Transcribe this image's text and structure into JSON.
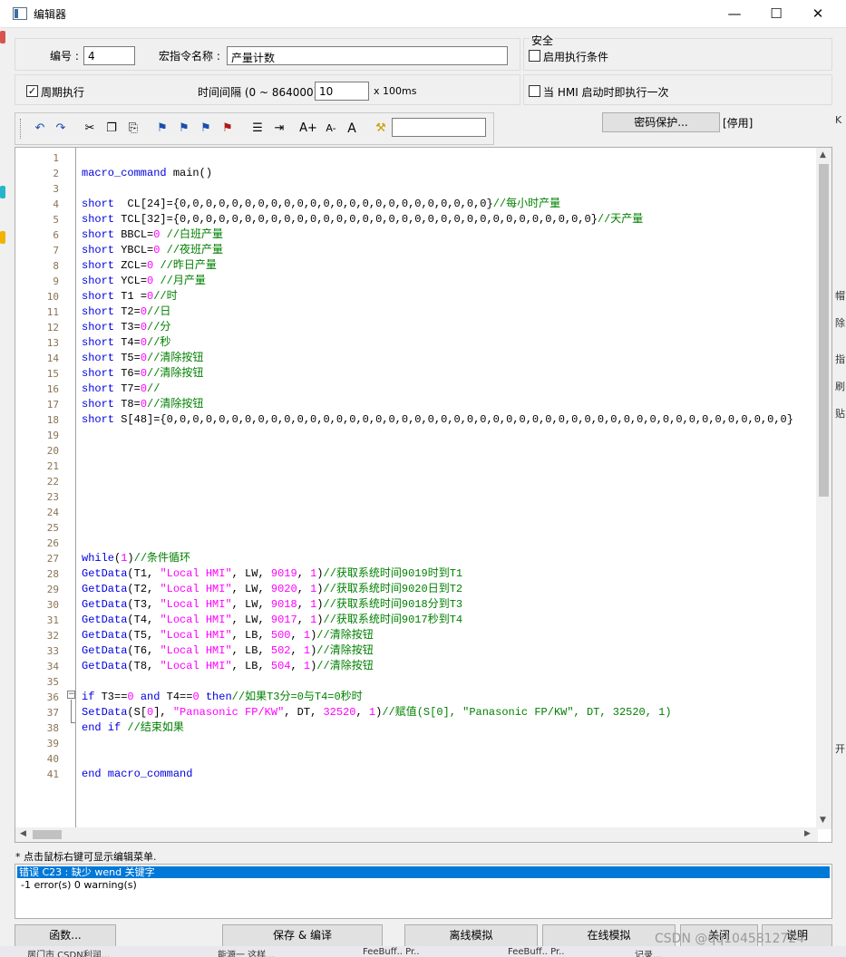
{
  "window": {
    "title": "编辑器",
    "min_icon": "minimize-icon",
    "max_icon": "maximize-icon",
    "close_icon": "close-icon"
  },
  "form": {
    "number_label": "编号 :",
    "number_value": "4",
    "macro_name_label": "宏指令名称 :",
    "macro_name_value": "产量计数",
    "security_title": "安全",
    "enable_condition_label": "启用执行条件",
    "enable_condition_checked": false,
    "periodic_label": "周期执行",
    "periodic_checked": true,
    "interval_label": "时间间隔 (0 ~ 864000) :",
    "interval_value": "10",
    "interval_unit": "x 100ms",
    "hmi_startup_label": "当 HMI 启动时即执行一次",
    "hmi_startup_checked": false,
    "password_button": "密码保护...",
    "status": "[停用]"
  },
  "toolbar": {
    "icons": [
      "undo-icon",
      "redo-icon",
      "cut-icon",
      "copy-icon",
      "paste-icon",
      "bookmark-icon",
      "bookmark-next-icon",
      "bookmark-prev-icon",
      "bookmark-clear-icon",
      "list-icon",
      "indent-icon",
      "font-increase-icon",
      "font-decrease-icon",
      "font-icon",
      "find-icon"
    ],
    "font_increase": "A+",
    "font_decrease": "A-",
    "font": "A",
    "search_value": ""
  },
  "code_lines": [
    {
      "n": "1",
      "html": ""
    },
    {
      "n": "2",
      "html": "<span class='kw'>macro_command</span> main()"
    },
    {
      "n": "3",
      "html": ""
    },
    {
      "n": "4",
      "html": "<span class='kw'>short</span>  CL[24]={0,0,0,0,0,0,0,0,0,0,0,0,0,0,0,0,0,0,0,0,0,0,0,0}<span class='cm'>//每小时产量</span>"
    },
    {
      "n": "5",
      "html": "<span class='kw'>short</span> TCL[32]={0,0,0,0,0,0,0,0,0,0,0,0,0,0,0,0,0,0,0,0,0,0,0,0,0,0,0,0,0,0,0,0}<span class='cm'>//天产量</span>"
    },
    {
      "n": "6",
      "html": "<span class='kw'>short</span> BBCL=<span class='num'>0</span> <span class='cm'>//白班产量</span>"
    },
    {
      "n": "7",
      "html": "<span class='kw'>short</span> YBCL=<span class='num'>0</span> <span class='cm'>//夜班产量</span>"
    },
    {
      "n": "8",
      "html": "<span class='kw'>short</span> ZCL=<span class='num'>0</span> <span class='cm'>//昨日产量</span>"
    },
    {
      "n": "9",
      "html": "<span class='kw'>short</span> YCL=<span class='num'>0</span> <span class='cm'>//月产量</span>"
    },
    {
      "n": "10",
      "html": "<span class='kw'>short</span> T1 =<span class='num'>0</span><span class='cm'>//时</span>"
    },
    {
      "n": "11",
      "html": "<span class='kw'>short</span> T2=<span class='num'>0</span><span class='cm'>//日</span>"
    },
    {
      "n": "12",
      "html": "<span class='kw'>short</span> T3=<span class='num'>0</span><span class='cm'>//分</span>"
    },
    {
      "n": "13",
      "html": "<span class='kw'>short</span> T4=<span class='num'>0</span><span class='cm'>//秒</span>"
    },
    {
      "n": "14",
      "html": "<span class='kw'>short</span> T5=<span class='num'>0</span><span class='cm'>//清除按钮</span>"
    },
    {
      "n": "15",
      "html": "<span class='kw'>short</span> T6=<span class='num'>0</span><span class='cm'>//清除按钮</span>"
    },
    {
      "n": "16",
      "html": "<span class='kw'>short</span> T7=<span class='num'>0</span><span class='cm'>//</span>"
    },
    {
      "n": "17",
      "html": "<span class='kw'>short</span> T8=<span class='num'>0</span><span class='cm'>//清除按钮</span>"
    },
    {
      "n": "18",
      "html": "<span class='kw'>short</span> S[48]={0,0,0,0,0,0,0,0,0,0,0,0,0,0,0,0,0,0,0,0,0,0,0,0,0,0,0,0,0,0,0,0,0,0,0,0,0,0,0,0,0,0,0,0,0,0,0,0}"
    },
    {
      "n": "19",
      "html": ""
    },
    {
      "n": "20",
      "html": ""
    },
    {
      "n": "21",
      "html": ""
    },
    {
      "n": "22",
      "html": ""
    },
    {
      "n": "23",
      "html": ""
    },
    {
      "n": "24",
      "html": ""
    },
    {
      "n": "25",
      "html": ""
    },
    {
      "n": "26",
      "html": ""
    },
    {
      "n": "27",
      "html": "<span class='kw'>while</span>(<span class='num'>1</span>)<span class='cm'>//条件循环</span>"
    },
    {
      "n": "28",
      "html": "<span class='fn'>GetData</span>(T1, <span class='str'>\"Local HMI\"</span>, LW, <span class='num'>9019</span>, <span class='num'>1</span>)<span class='cm'>//获取系统时间9019时到T1</span>"
    },
    {
      "n": "29",
      "html": "<span class='fn'>GetData</span>(T2, <span class='str'>\"Local HMI\"</span>, LW, <span class='num'>9020</span>, <span class='num'>1</span>)<span class='cm'>//获取系统时间9020日到T2</span>"
    },
    {
      "n": "30",
      "html": "<span class='fn'>GetData</span>(T3, <span class='str'>\"Local HMI\"</span>, LW, <span class='num'>9018</span>, <span class='num'>1</span>)<span class='cm'>//获取系统时间9018分到T3</span>"
    },
    {
      "n": "31",
      "html": "<span class='fn'>GetData</span>(T4, <span class='str'>\"Local HMI\"</span>, LW, <span class='num'>9017</span>, <span class='num'>1</span>)<span class='cm'>//获取系统时间9017秒到T4</span>"
    },
    {
      "n": "32",
      "html": "<span class='fn'>GetData</span>(T5, <span class='str'>\"Local HMI\"</span>, LB, <span class='num'>500</span>, <span class='num'>1</span>)<span class='cm'>//清除按钮</span>"
    },
    {
      "n": "33",
      "html": "<span class='fn'>GetData</span>(T6, <span class='str'>\"Local HMI\"</span>, LB, <span class='num'>502</span>, <span class='num'>1</span>)<span class='cm'>//清除按钮</span>"
    },
    {
      "n": "34",
      "html": "<span class='fn'>GetData</span>(T8, <span class='str'>\"Local HMI\"</span>, LB, <span class='num'>504</span>, <span class='num'>1</span>)<span class='cm'>//清除按钮</span>"
    },
    {
      "n": "35",
      "html": ""
    },
    {
      "n": "36",
      "html": "<span class='kw'>if</span> T3==<span class='num'>0</span> <span class='kw'>and</span> T4==<span class='num'>0</span> <span class='kw'>then</span><span class='cm'>//如果T3分=0与T4=0秒时</span>"
    },
    {
      "n": "37",
      "html": "<span class='fn'>SetData</span>(S[<span class='num'>0</span>], <span class='str'>\"Panasonic FP/KW\"</span>, DT, <span class='num'>32520</span>, <span class='num'>1</span>)<span class='cm'>//赋值(S[0], \"Panasonic FP/KW\", DT, 32520, 1)</span>"
    },
    {
      "n": "38",
      "html": "<span class='kw'>end if</span> <span class='cm'>//结束如果</span>"
    },
    {
      "n": "39",
      "html": ""
    },
    {
      "n": "40",
      "html": ""
    },
    {
      "n": "41",
      "html": "<span class='kw'>end macro_command</span>"
    }
  ],
  "hint": "* 点击鼠标右键可显示编辑菜单.",
  "errors": {
    "line": "错误 C23 : 缺少 wend 关键字",
    "summary": "-1 error(s) 0 warning(s)"
  },
  "buttons": {
    "functions": "函数...",
    "save_compile": "保存 & 编译",
    "offline_sim": "离线模拟",
    "online_sim": "在线模拟",
    "close": "关闭",
    "help": "说明"
  },
  "watermark": "CSDN @qq1045812724",
  "taskbar": [
    "居门市 CSDN利润...",
    "能源一 这样...",
    "FeeBuff.. Pr..",
    "FeeBuff.. Pr..",
    "记录..."
  ],
  "right_strip": [
    "K",
    "帽",
    "除",
    "指",
    "刷",
    "贴",
    "开"
  ]
}
